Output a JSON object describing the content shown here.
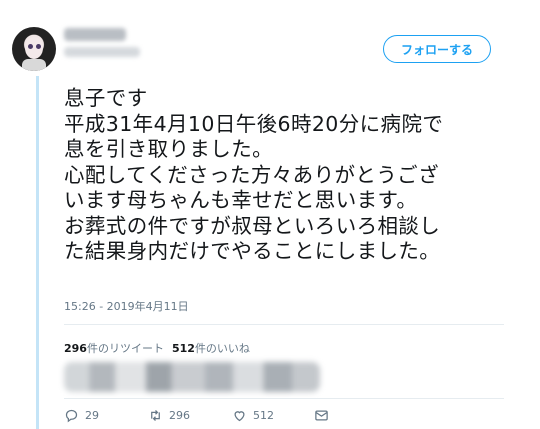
{
  "follow_button": {
    "label": "フォローする"
  },
  "tweet": {
    "lines": [
      "息子です",
      "平成31年4月10日午後6時20分に病院で",
      "息を引き取りました。",
      "心配してくださった方々ありがとうござ",
      "います母ちゃんも幸せだと思います。",
      "お葬式の件ですが叔母といろいろ相談し",
      "た結果身内だけでやることにしました。"
    ],
    "timestamp": "15:26 - 2019年4月11日"
  },
  "stats": {
    "retweets_count": "296",
    "retweets_label": "件のリツイート",
    "likes_count": "512",
    "likes_label": "件のいいね"
  },
  "actions": {
    "reply_count": "29",
    "retweet_count": "296",
    "like_count": "512"
  },
  "colors": {
    "accent": "#1da1f2",
    "muted_text": "#657786",
    "thread_line": "#c4e4f7"
  },
  "icons": [
    "avatar",
    "reply-icon",
    "retweet-icon",
    "like-icon",
    "message-icon"
  ]
}
